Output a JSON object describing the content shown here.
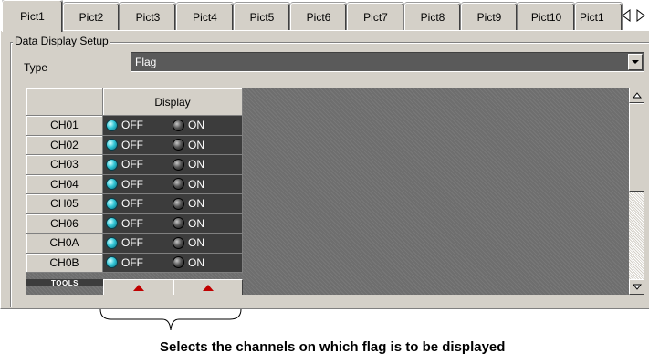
{
  "tabs": [
    "Pict1",
    "Pict2",
    "Pict3",
    "Pict4",
    "Pict5",
    "Pict6",
    "Pict7",
    "Pict8",
    "Pict9",
    "Pict10",
    "Pict1"
  ],
  "active_tab": "Pict1",
  "group_title": "Data Display Setup",
  "type_label": "Type",
  "type_value": "Flag",
  "display_header": "Display",
  "channels": [
    "CH01",
    "CH02",
    "CH03",
    "CH04",
    "CH05",
    "CH06",
    "CH0A",
    "CH0B"
  ],
  "radio_off": "OFF",
  "radio_on": "ON",
  "selected_option": "OFF",
  "tools_label": "TOOLS",
  "caption": "Selects the channels on which flag is to be displayed",
  "colors": {
    "panel": "#d4d0c8",
    "grid_background": "#6e6e6e",
    "cell_background": "#3c3c3c",
    "led_selected": "#33c6d6",
    "led_unselected": "#333333",
    "tools_arrow": "#c00000"
  },
  "scrollbar_position": 0
}
